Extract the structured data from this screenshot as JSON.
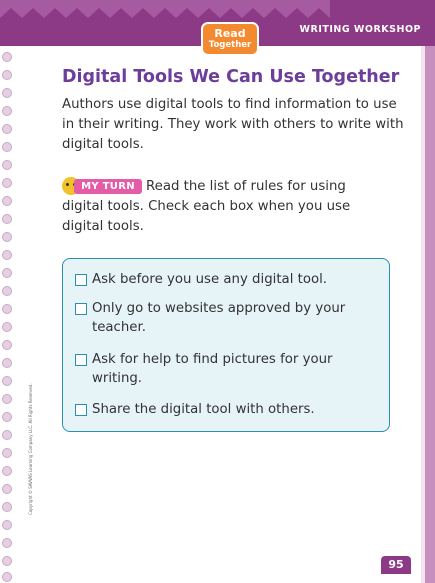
{
  "header": {
    "section_label": "WRITING WORKSHOP",
    "badge_line1": "Read",
    "badge_line2": "Together"
  },
  "main": {
    "title": "Digital Tools We Can Use Together",
    "intro": "Authors use digital tools to find information to use in their writing. They work with others to write with digital tools.",
    "my_turn_label": "MY TURN",
    "my_turn_instruction": "Read the list of rules for using digital tools. Check each box when you use digital tools.",
    "checklist": [
      "Ask before you use any digital tool.",
      "Only go to websites approved by your teacher.",
      "Ask for help to find pictures for your writing.",
      "Share the digital tool with others."
    ]
  },
  "footer": {
    "copyright": "Copyright © SAVVAS Learning Company LLC. All Rights Reserved.",
    "page_number": "95"
  },
  "colors": {
    "header": "#8c3a86",
    "title": "#6d3d9a",
    "panel_bg": "#e6f4f8",
    "panel_border": "#2a8fb2",
    "badge": "#f38a2f",
    "my_turn": "#e45ca6"
  }
}
